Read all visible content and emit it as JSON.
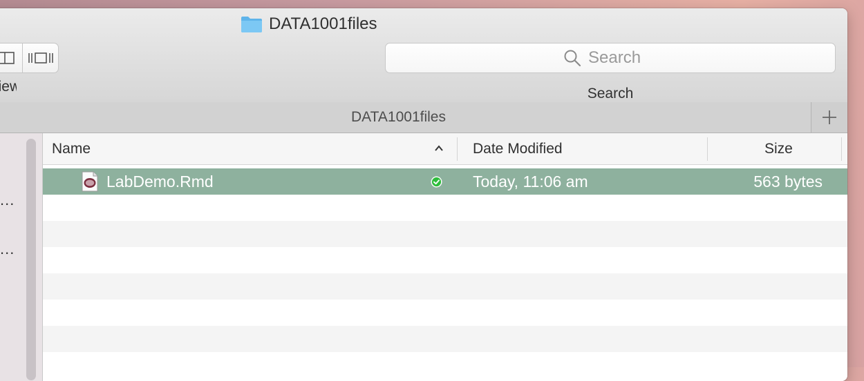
{
  "window": {
    "title": "DATA1001files",
    "title_icon": "folder-icon"
  },
  "toolbar": {
    "view_label": "View",
    "view_buttons": [
      "column-view-icon",
      "cover-flow-icon"
    ],
    "search_placeholder": "Search",
    "search_value": "",
    "search_label": "Search"
  },
  "tabbar": {
    "tab_title": "DATA1001files",
    "new_tab_icon": "plus-icon"
  },
  "sidebar": {
    "visible_items": [
      "...",
      "..."
    ]
  },
  "columns": {
    "name": "Name",
    "date_modified": "Date Modified",
    "size": "Size",
    "sort_indicator": "chevron-up-icon"
  },
  "files": [
    {
      "name": "LabDemo.Rmd",
      "icon": "rmd-file-icon",
      "status": "synced-check-icon",
      "date_modified": "Today, 11:06 am",
      "size": "563 bytes"
    }
  ],
  "colors": {
    "selection": "#8eb19e",
    "folder": "#5fb4ea",
    "status_ok": "#2ebd3c"
  }
}
